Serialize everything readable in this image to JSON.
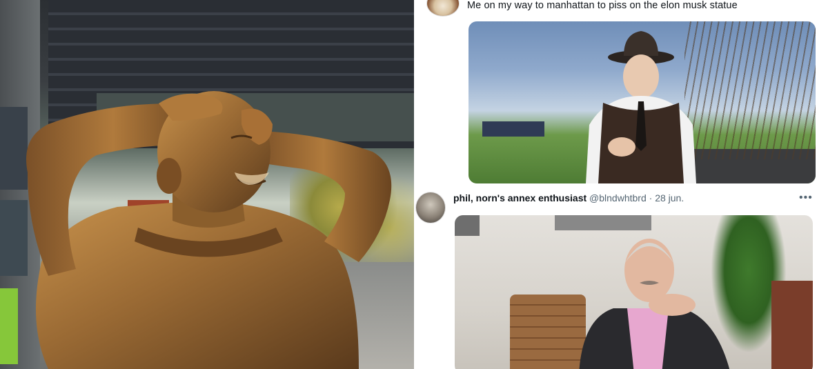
{
  "tweet1": {
    "text": "Me on my way to manhattan to piss on the elon musk statue"
  },
  "tweet2": {
    "display_name": "phil, norn's annex enthusiast",
    "handle": "@blndwhtbrd",
    "separator": "·",
    "date": "28 jun.",
    "more": "•••"
  },
  "colors": {
    "text_primary": "#0f1419",
    "text_secondary": "#536471",
    "bronze": "#8a5e2c"
  }
}
